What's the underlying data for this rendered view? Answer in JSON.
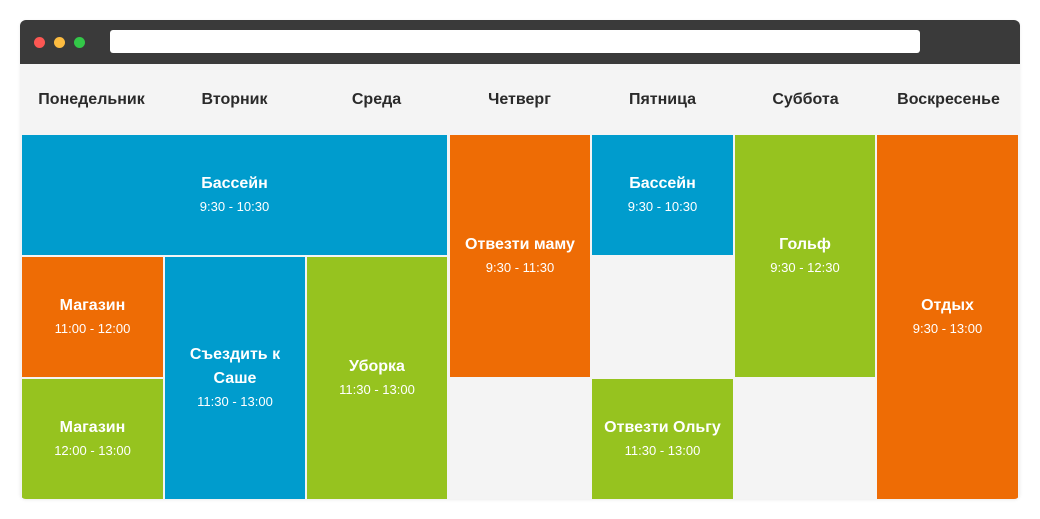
{
  "colors": {
    "blue": "#009ccd",
    "orange": "#ee6c05",
    "green": "#96c31f",
    "background": "#f4f4f4",
    "titlebar": "#3a3a3a"
  },
  "window": {
    "controls": [
      "close-icon",
      "minimize-icon",
      "maximize-icon"
    ],
    "address": ""
  },
  "days": [
    "Понедельник",
    "Вторник",
    "Среда",
    "Четверг",
    "Пятница",
    "Суббота",
    "Воскресенье"
  ],
  "events": [
    {
      "title": "Бассейн",
      "time": "9:30 - 10:30",
      "color": "blue",
      "days": [
        "Понедельник",
        "Вторник",
        "Среда"
      ]
    },
    {
      "title": "Магазин",
      "time": "11:00 - 12:00",
      "color": "orange",
      "days": [
        "Понедельник"
      ]
    },
    {
      "title": "Магазин",
      "time": "12:00 - 13:00",
      "color": "green",
      "days": [
        "Понедельник"
      ]
    },
    {
      "title": "Съездить к Саше",
      "time": "11:30 - 13:00",
      "color": "blue",
      "days": [
        "Вторник"
      ]
    },
    {
      "title": "Уборка",
      "time": "11:30 - 13:00",
      "color": "green",
      "days": [
        "Среда"
      ]
    },
    {
      "title": "Отвезти маму",
      "time": "9:30 - 11:30",
      "color": "orange",
      "days": [
        "Четверг"
      ]
    },
    {
      "title": "Бассейн",
      "time": "9:30 - 10:30",
      "color": "blue",
      "days": [
        "Пятница"
      ]
    },
    {
      "title": "Отвезти Ольгу",
      "time": "11:30 - 13:00",
      "color": "green",
      "days": [
        "Пятница"
      ]
    },
    {
      "title": "Гольф",
      "time": "9:30 - 12:30",
      "color": "green",
      "days": [
        "Суббота"
      ]
    },
    {
      "title": "Отдых",
      "time": "9:30 - 13:00",
      "color": "orange",
      "days": [
        "Воскресенье"
      ]
    }
  ]
}
